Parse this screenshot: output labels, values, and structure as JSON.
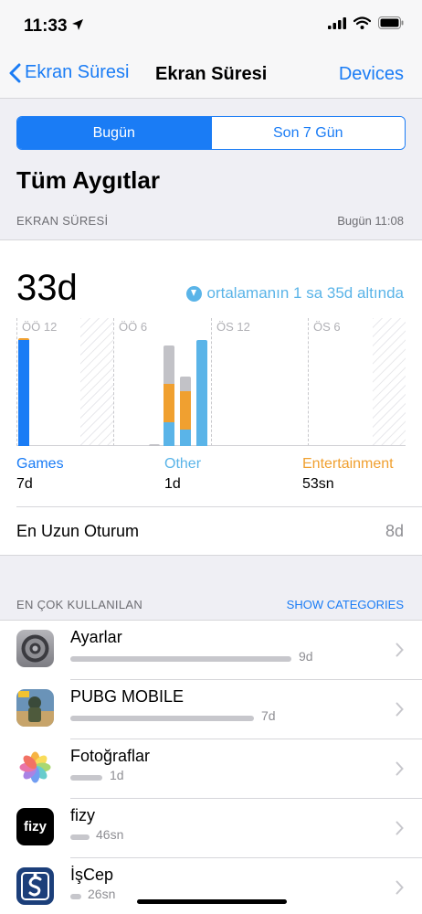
{
  "status_bar": {
    "time": "11:33"
  },
  "nav": {
    "back_label": "Ekran Süresi",
    "title": "Ekran Süresi",
    "right_label": "Devices"
  },
  "segmented": {
    "today": "Bugün",
    "week": "Son 7 Gün",
    "selected": "today"
  },
  "device_title": "Tüm Aygıtlar",
  "screen_time_section": {
    "label": "EKRAN SÜRESİ",
    "updated": "Bugün 11:08"
  },
  "summary": {
    "total": "33d",
    "average_note": "ortalamanın 1 sa 35d altında"
  },
  "chart_data": {
    "type": "bar",
    "x_tick_labels": [
      "ÖÖ 12",
      "ÖÖ 6",
      "ÖS 12",
      "ÖS 6"
    ],
    "categories": [
      "12",
      "1",
      "2",
      "3",
      "4",
      "5",
      "6",
      "7",
      "8",
      "9",
      "10",
      "11"
    ],
    "series": [
      {
        "name": "Games",
        "color": "#1a7cf5",
        "values": [
          58,
          0,
          0,
          0,
          0,
          0,
          0,
          0,
          0,
          0,
          0,
          0
        ]
      },
      {
        "name": "Other",
        "color": "#5ab4e8",
        "values": [
          0,
          0,
          0,
          0,
          0,
          0,
          0,
          0,
          13,
          9,
          0,
          58
        ]
      },
      {
        "name": "Entertainment",
        "color": "#f0a030",
        "values": [
          1,
          0,
          0,
          0,
          0,
          0,
          0,
          0,
          21,
          21,
          0,
          0
        ]
      },
      {
        "name": "",
        "color": "#c2c2c7",
        "values": [
          0,
          0,
          1,
          0,
          0,
          0,
          0,
          3,
          21,
          8,
          0,
          0
        ]
      }
    ],
    "ylim": [
      0,
      60
    ],
    "grid": true
  },
  "categories": [
    {
      "name": "Games",
      "value": "7d",
      "color": "#1a7cf5"
    },
    {
      "name": "Other",
      "value": "1d",
      "color": "#5ab4e8"
    },
    {
      "name": "Entertainment",
      "value": "53sn",
      "color": "#f0a030"
    }
  ],
  "longest_session": {
    "label": "En Uzun Oturum",
    "value": "8d"
  },
  "most_used": {
    "label": "EN ÇOK KULLANILAN",
    "action": "SHOW CATEGORIES"
  },
  "apps": [
    {
      "name": "Ayarlar",
      "time": "9d",
      "icon": "settings-icon",
      "usage_fraction": 1.0
    },
    {
      "name": "PUBG MOBILE",
      "time": "7d",
      "icon": "pubg-icon",
      "usage_fraction": 0.8
    },
    {
      "name": "Fotoğraflar",
      "time": "1d",
      "icon": "photos-icon",
      "usage_fraction": 0.15
    },
    {
      "name": "fizy",
      "time": "46sn",
      "icon": "fizy-icon",
      "usage_fraction": 0.09
    },
    {
      "name": "İşCep",
      "time": "26sn",
      "icon": "iscep-icon",
      "usage_fraction": 0.05
    }
  ],
  "icon_labels": {
    "fizy": "fizy"
  }
}
